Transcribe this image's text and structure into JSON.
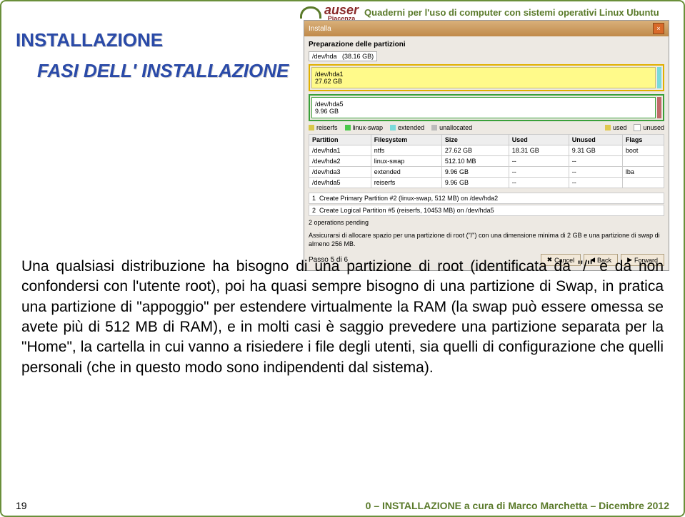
{
  "header": {
    "tagline": "Quaderni per l'uso di computer con sistemi operativi Linux Ubuntu",
    "logo_name": "auser",
    "logo_sub": "Piacenza"
  },
  "titles": {
    "section": "INSTALLAZIONE",
    "sub": "FASI DELL' INSTALLAZIONE"
  },
  "installer": {
    "window_title": "Installa",
    "panel_title": "Preparazione delle partizioni",
    "disk_selector": "/dev/hda",
    "disk_size": "(38.16 GB)",
    "bar": {
      "p1_name": "/dev/hda1",
      "p1_size": "27.62 GB",
      "p2_name": "/dev/hda5",
      "p2_size": "9.96 GB"
    },
    "legend": {
      "reiserfs": "reiserfs",
      "linuxswap": "linux-swap",
      "extended": "extended",
      "unallocated": "unallocated",
      "used": "used",
      "unused": "unused"
    },
    "cols": {
      "partition": "Partition",
      "filesystem": "Filesystem",
      "size": "Size",
      "used": "Used",
      "unused": "Unused",
      "flags": "Flags"
    },
    "rows": [
      {
        "p": "/dev/hda1",
        "fs": "ntfs",
        "sz": "27.62 GB",
        "u": "18.31 GB",
        "un": "9.31 GB",
        "f": "boot"
      },
      {
        "p": "/dev/hda2",
        "fs": "linux-swap",
        "sz": "512.10 MB",
        "u": "--",
        "un": "--",
        "f": ""
      },
      {
        "p": "/dev/hda3",
        "fs": "extended",
        "sz": "9.96 GB",
        "u": "--",
        "un": "--",
        "f": "lba"
      },
      {
        "p": "/dev/hda5",
        "fs": "reiserfs",
        "sz": "9.96 GB",
        "u": "--",
        "un": "--",
        "f": ""
      }
    ],
    "pending": [
      "Create Primary Partition #2 (linux-swap, 512 MB) on /dev/hda2",
      "Create Logical Partition #5 (reiserfs, 10453 MB) on /dev/hda5"
    ],
    "pending_title": "2 operations pending",
    "hint": "Assicurarsi di allocare spazio per una partizione di root (\"/\") con una dimensione minima di 2 GB e una partizione di swap di almeno 256 MB.",
    "step": "Passo 5 di 6",
    "buttons": {
      "cancel": "Cancel",
      "back": "Back",
      "forward": "Forward"
    }
  },
  "body": "Una qualsiasi distribuzione ha bisogno di una partizione di root (identificata da \"/\" e da non confondersi con l'utente root), poi ha quasi sempre bisogno di una partizione di Swap, in pratica una partizione di \"appoggio\" per estendere virtualmente la RAM (la swap può essere omessa se avete più di 512 MB di RAM), e in molti casi è saggio prevedere una partizione separata per la \"Home\", la cartella in cui vanno a risiedere i file degli utenti, sia quelli di configurazione che quelli personali (che in questo modo sono indipendenti dal sistema).",
  "footer": {
    "page": "19",
    "ref": "0 – INSTALLAZIONE a cura di Marco Marchetta – Dicembre 2012"
  }
}
